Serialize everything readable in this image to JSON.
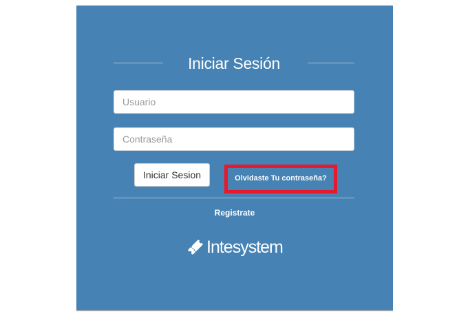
{
  "login": {
    "title": "Iniciar Sesión",
    "username_placeholder": "Usuario",
    "password_placeholder": "Contraseña",
    "submit_label": "Iniciar Sesion",
    "forgot_label": "Olvidaste Tu contraseña?",
    "register_label": "Registrate"
  },
  "brand": {
    "name": "Intesystem",
    "icon": "ticket-icon"
  },
  "colors": {
    "panel_bg": "#4682b4",
    "highlight_border": "#e8192c",
    "text": "#ffffff"
  }
}
